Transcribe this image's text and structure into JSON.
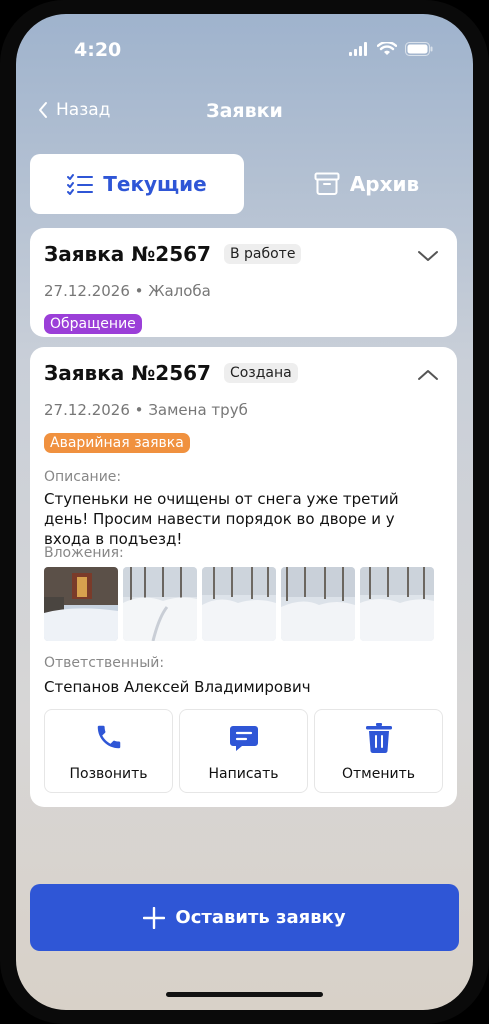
{
  "status_bar": {
    "time": "4:20"
  },
  "header": {
    "back_label": "Назад",
    "title": "Заявки"
  },
  "tabs": [
    {
      "label": "Текущие",
      "icon": "checklist-icon",
      "active": true
    },
    {
      "label": "Архив",
      "icon": "archive-box-icon",
      "active": false
    }
  ],
  "requests": [
    {
      "title": "Заявка №2567",
      "status": "В работе",
      "date": "27.12.2026",
      "category": "Жалоба",
      "separator": "•",
      "tag": "Обращение",
      "tag_color": "#9b3fd8",
      "expanded": false
    },
    {
      "title": "Заявка №2567",
      "status": "Создана",
      "date": "27.12.2026",
      "category": "Замена труб",
      "separator": "•",
      "tag": "Аварийная заявка",
      "tag_color": "#f0913f",
      "expanded": true,
      "description_label": "Описание:",
      "description": "Ступеньки не очищены от снега уже третий день! Просим навести порядок во дворе и у входа в подъезд!",
      "attachments_label": "Вложения:",
      "attachments": [
        "photo-1",
        "photo-2",
        "photo-3",
        "photo-4",
        "photo-5"
      ],
      "responsible_label": "Ответственный:",
      "responsible": "Степанов Алексей Владимирович",
      "actions": [
        {
          "label": "Позвонить",
          "icon": "phone-icon"
        },
        {
          "label": "Написать",
          "icon": "message-icon"
        },
        {
          "label": "Отменить",
          "icon": "trash-icon"
        }
      ]
    }
  ],
  "cta": {
    "label": "Оставить заявку",
    "icon": "plus-icon"
  },
  "colors": {
    "accent": "#2f56d6"
  }
}
